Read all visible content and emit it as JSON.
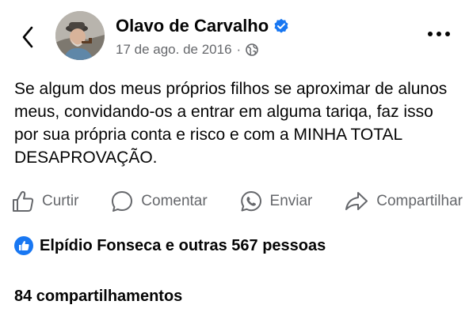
{
  "post": {
    "author": "Olavo de Carvalho",
    "date": "17 de ago. de 2016",
    "separator": "·",
    "text": "Se algum dos meus próprios filhos se aproximar de alunos meus, convidando-os a entrar em alguma tariqa, faz isso por sua própria conta e risco e com a MINHA TOTAL DESAPROVAÇÃO."
  },
  "actions": {
    "like": "Curtir",
    "comment": "Comentar",
    "send": "Enviar",
    "share": "Compartilhar"
  },
  "reactions": {
    "summary": "Elpídio Fonseca e outras 567 pessoas"
  },
  "shares": {
    "summary": "84 compartilhamentos"
  },
  "icons": {
    "back": "chevron-left-icon",
    "verified": "verified-badge-icon",
    "audience": "globe-icon",
    "more": "more-horizontal-icon",
    "like": "thumbs-up-icon",
    "comment": "speech-bubble-icon",
    "send": "whatsapp-icon",
    "share": "share-arrow-icon",
    "reaction": "like-reaction-icon"
  },
  "colors": {
    "primary_text": "#050505",
    "secondary_text": "#65676b",
    "facebook_blue": "#1877f2"
  }
}
